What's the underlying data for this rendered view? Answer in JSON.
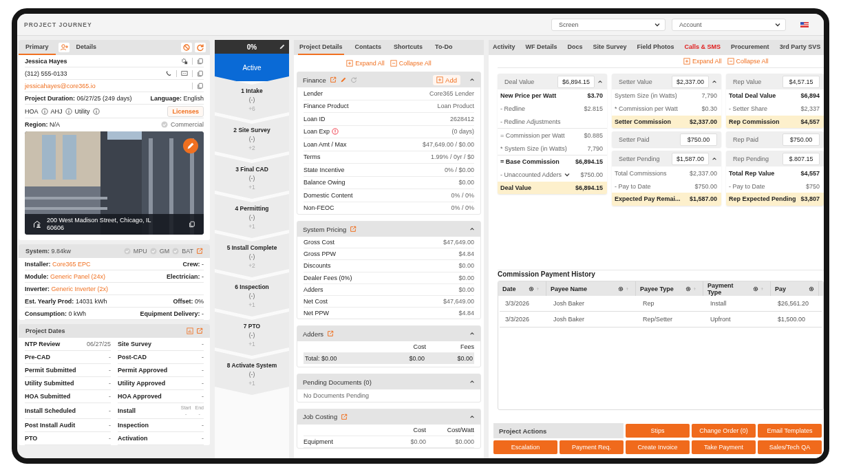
{
  "header": {
    "title": "PROJECT JOURNEY",
    "dropdowns": [
      {
        "placeholder": "Screen"
      },
      {
        "placeholder": "Account"
      }
    ]
  },
  "contact": {
    "tabs": [
      {
        "label": "Primary",
        "selected": true
      },
      {
        "label": "Details",
        "selected": false
      }
    ],
    "name": "Jessica Hayes",
    "phone": "(312) 555-0133",
    "email": "jessicahayes@core365.io",
    "duration": {
      "label": "Project Duration:",
      "value": "06/27/25 (249 days)"
    },
    "language": {
      "label": "Language:",
      "value": "English"
    },
    "infos": [
      "HOA",
      "AHJ",
      "Utility"
    ],
    "licenses": "Licenses",
    "region": {
      "label": "Region:",
      "value": "N/A"
    },
    "commercial": {
      "label": "Commercial",
      "checked": false
    },
    "photo": {
      "kind": "picture",
      "address": "200 West Madison Street, Chicago, IL 60606"
    }
  },
  "system": {
    "label": "System:",
    "value": "9.84kw",
    "flags": [
      {
        "label": "MPU",
        "checked": false
      },
      {
        "label": "GM",
        "checked": false
      },
      {
        "label": "BAT",
        "checked": false
      }
    ],
    "rows": [
      {
        "left": {
          "label": "Installer:",
          "value": "Core365 EPC",
          "link": true
        },
        "right": {
          "label": "Crew:",
          "value": "-"
        }
      },
      {
        "left": {
          "label": "Module:",
          "value": "Generic Panel  (24x)",
          "link": true
        },
        "right": {
          "label": "Electrician:",
          "value": "-"
        }
      },
      {
        "left": {
          "label": "Inverter:",
          "value": "Generic Inverter  (2x)",
          "link": true
        }
      },
      {
        "left": {
          "label": "Est. Yearly Prod:",
          "value": "14031 kWh",
          "link": false
        },
        "right": {
          "label": "Offset:",
          "value": "0%"
        }
      },
      {
        "left": {
          "label": "Consumption:",
          "value": "0 kWh",
          "link": false
        },
        "right": {
          "label": "Equipment Delivery:",
          "value": "-"
        }
      }
    ]
  },
  "dates": {
    "title": "Project Dates",
    "rows": [
      {
        "left": {
          "label": "NTP Review",
          "value": "06/27/25"
        },
        "right": {
          "kind": "single",
          "label": "Site Survey",
          "value": "-"
        }
      },
      {
        "left": {
          "label": "Pre-CAD",
          "value": "-"
        },
        "right": {
          "kind": "single",
          "label": "Post-CAD",
          "value": "-"
        }
      },
      {
        "left": {
          "label": "Permit Submitted",
          "value": "-"
        },
        "right": {
          "kind": "single",
          "label": "Permit Approved",
          "value": "-"
        }
      },
      {
        "left": {
          "label": "Utility Submitted",
          "value": "-"
        },
        "right": {
          "kind": "single",
          "label": "Utility Approved",
          "value": "-"
        }
      },
      {
        "left": {
          "label": "HOA Submitted",
          "value": "-"
        },
        "right": {
          "kind": "single",
          "label": "HOA Approved",
          "value": "-"
        }
      },
      {
        "left": {
          "label": "Install Scheduled",
          "value": "-"
        },
        "right": {
          "kind": "range",
          "label": "Install",
          "start_label": "Start",
          "end_label": "End",
          "start": "-",
          "end": "-"
        }
      },
      {
        "left": {
          "label": "Post Install Audit",
          "value": "-"
        },
        "right": {
          "kind": "single",
          "label": "Inspection",
          "value": "-"
        }
      },
      {
        "left": {
          "label": "PTO",
          "value": "-"
        },
        "right": {
          "kind": "single",
          "label": "Activation",
          "value": "-"
        }
      }
    ]
  },
  "stages": {
    "progress": "0%",
    "status": "Active",
    "steps": [
      {
        "name": "1 Intake",
        "value": "(-)",
        "delta": "+6"
      },
      {
        "name": "2 Site Survey",
        "value": "(-)",
        "delta": "+2"
      },
      {
        "name": "3 Final CAD",
        "value": "(-)",
        "delta": "+1"
      },
      {
        "name": "4 Permitting",
        "value": "(-)",
        "delta": "+1"
      },
      {
        "name": "5 Install Complete",
        "value": "(-)",
        "delta": "+2"
      },
      {
        "name": "6 Inspection",
        "value": "(-)",
        "delta": "+1"
      },
      {
        "name": "7 PTO",
        "value": "(-)",
        "delta": "+1"
      },
      {
        "name": "8 Activate System",
        "value": "(-)",
        "delta": "+1"
      }
    ]
  },
  "details": {
    "tabs": [
      {
        "label": "Project Details",
        "selected": true
      },
      {
        "label": "Contacts",
        "selected": false
      },
      {
        "label": "Shortcuts",
        "selected": false
      },
      {
        "label": "To-Do",
        "selected": false
      }
    ],
    "expand": "Expand All",
    "collapse": "Collapse All",
    "finance": {
      "title": "Finance",
      "add": "Add",
      "rows": [
        {
          "label": "Lender",
          "value": "Core365 Lender",
          "alert": false
        },
        {
          "label": "Finance Product",
          "value": "Loan Product",
          "alert": false
        },
        {
          "label": "Loan ID",
          "value": "2628412",
          "alert": false
        },
        {
          "label": "Loan Exp",
          "value": "(0 days)",
          "alert": true
        },
        {
          "label": "Loan Amt / Max",
          "value": "$47,649.00 / $0.00",
          "alert": false
        },
        {
          "label": "Terms",
          "value": "1.99% / 0yr / $0",
          "alert": false
        },
        {
          "label": "State Incentive",
          "value": "0% / $0.00",
          "alert": false
        },
        {
          "label": "Balance Owing",
          "value": "$0.00",
          "alert": false
        },
        {
          "label": "Domestic Content",
          "value": "0% / 0%",
          "alert": false
        },
        {
          "label": "Non-FEOC",
          "value": "0% / 0%",
          "alert": false
        }
      ]
    },
    "pricing": {
      "title": "System Pricing",
      "rows": [
        {
          "label": "Gross Cost",
          "value": "$47,649.00"
        },
        {
          "label": "Gross PPW",
          "value": "$4.84"
        },
        {
          "label": "Discounts",
          "value": "$0.00"
        },
        {
          "label": "Dealer Fees (0%)",
          "value": "$0.00"
        },
        {
          "label": "Adders",
          "value": "$0.00"
        },
        {
          "label": "Net Cost",
          "value": "$47,649.00"
        },
        {
          "label": "Net PPW",
          "value": "$4.84"
        }
      ]
    },
    "adders": {
      "title": "Adders",
      "columns": [
        "Cost",
        "Fees"
      ],
      "total": [
        "Total: $0.00",
        "$0.00",
        "$0.00"
      ]
    },
    "pending": {
      "title": "Pending Documents (0)",
      "empty": "No Documents Pending"
    },
    "job_costing": {
      "title": "Job Costing",
      "columns": [
        "",
        "Cost",
        "Cost/Watt"
      ],
      "rows": [
        [
          "Equipment",
          "$0.00",
          "$0.000"
        ]
      ]
    }
  },
  "commission": {
    "tabs": [
      {
        "label": "Activity",
        "selected": false
      },
      {
        "label": "WF Details",
        "selected": false
      },
      {
        "label": "Docs",
        "selected": false
      },
      {
        "label": "Site Survey",
        "selected": false
      },
      {
        "label": "Field Photos",
        "selected": false
      },
      {
        "label": "Calls & SMS",
        "selected": true
      },
      {
        "label": "Procurement",
        "selected": false
      },
      {
        "label": "3rd Party SVS",
        "selected": false
      }
    ],
    "expand": "Expand All",
    "collapse": "Collapse All",
    "columns": [
      [
        {
          "label": "Deal Value",
          "value": "$6,894.15",
          "collapsible": true,
          "rows": [
            {
              "kind": "strong",
              "label": "New Price per Watt",
              "value": "$3.70"
            },
            {
              "kind": "sub",
              "label": "- Redline",
              "value": "$2.815"
            },
            {
              "kind": "sub",
              "label": "- Redline Adjustments"
            },
            {
              "kind": "sub",
              "label": "= Commission per Watt",
              "value": "$0.885",
              "divider": true
            },
            {
              "kind": "sub",
              "label": "* System Size (in Watts)",
              "value": "7,790"
            },
            {
              "kind": "strong",
              "label": "= Base Commission",
              "value": "$6,894.15",
              "divider": true
            },
            {
              "kind": "dropdown",
              "label": "- Unaccounted Adders",
              "value": "$750.00"
            },
            {
              "kind": "total",
              "label": "Deal Value",
              "value": "$6,894.15"
            }
          ]
        }
      ],
      [
        {
          "label": "Setter Value",
          "value": "$2,337.00",
          "collapsible": true,
          "rows": [
            {
              "kind": "sub",
              "label": "System Size (in Watts)",
              "value": "7,790"
            },
            {
              "kind": "sub",
              "label": "* Commission per Watt",
              "value": "$0.30"
            },
            {
              "kind": "total",
              "label": "Setter Commission",
              "value": "$2,337.00"
            }
          ]
        },
        {
          "label": "Setter Paid",
          "value": "$750.00",
          "collapsible": false
        },
        {
          "label": "Setter Pending",
          "value": "$1,587.00",
          "collapsible": true,
          "rows": [
            {
              "kind": "sub",
              "label": "Total Commissions",
              "value": "$2,337.00"
            },
            {
              "kind": "sub",
              "label": "- Pay to Date",
              "value": "$750.00"
            },
            {
              "kind": "total",
              "label": "Expected Pay Remai...",
              "value": "$1,587.00"
            }
          ]
        }
      ],
      [
        {
          "label": "Rep Value",
          "value": "$4,57.15",
          "collapsible": false,
          "rows": [
            {
              "kind": "strong",
              "label": "Total Deal Value",
              "value": "$6,894"
            },
            {
              "kind": "sub",
              "label": "- Setter Share",
              "value": "$2,337"
            },
            {
              "kind": "total",
              "label": "Rep Commission",
              "value": "$4,557"
            }
          ]
        },
        {
          "label": "Rep Paid",
          "value": "$750.00",
          "collapsible": false
        },
        {
          "label": "Rep Pending",
          "value": "$.807.15",
          "collapsible": false,
          "rows": [
            {
              "kind": "strong",
              "label": "Total Rep Value",
              "value": "$4,557"
            },
            {
              "kind": "sub",
              "label": "- Pay to Date",
              "value": "$750"
            },
            {
              "kind": "total",
              "label": "Rep Expected Pending",
              "value": "$3,807"
            }
          ]
        }
      ]
    ],
    "history": {
      "title": "Commission Payment History",
      "columns": [
        "Date",
        "Payee Name",
        "Payee Type",
        "Payment Type",
        "Pay"
      ],
      "rows": [
        [
          "3/3/2026",
          "Josh Baker",
          "Rep",
          "Install",
          "$26,561.20"
        ],
        [
          "3/3/2026",
          "Josh Baker",
          "Rep/Setter",
          "Upfront",
          "$1,500.00"
        ]
      ]
    },
    "actions": {
      "title": "Project Actions",
      "buttons": [
        "Stips",
        "Change Order (0)",
        "Email Templates",
        "Escalation",
        "Payment Req.",
        "Create Invoice",
        "Take Payment",
        "Sales/Tech QA"
      ]
    }
  }
}
